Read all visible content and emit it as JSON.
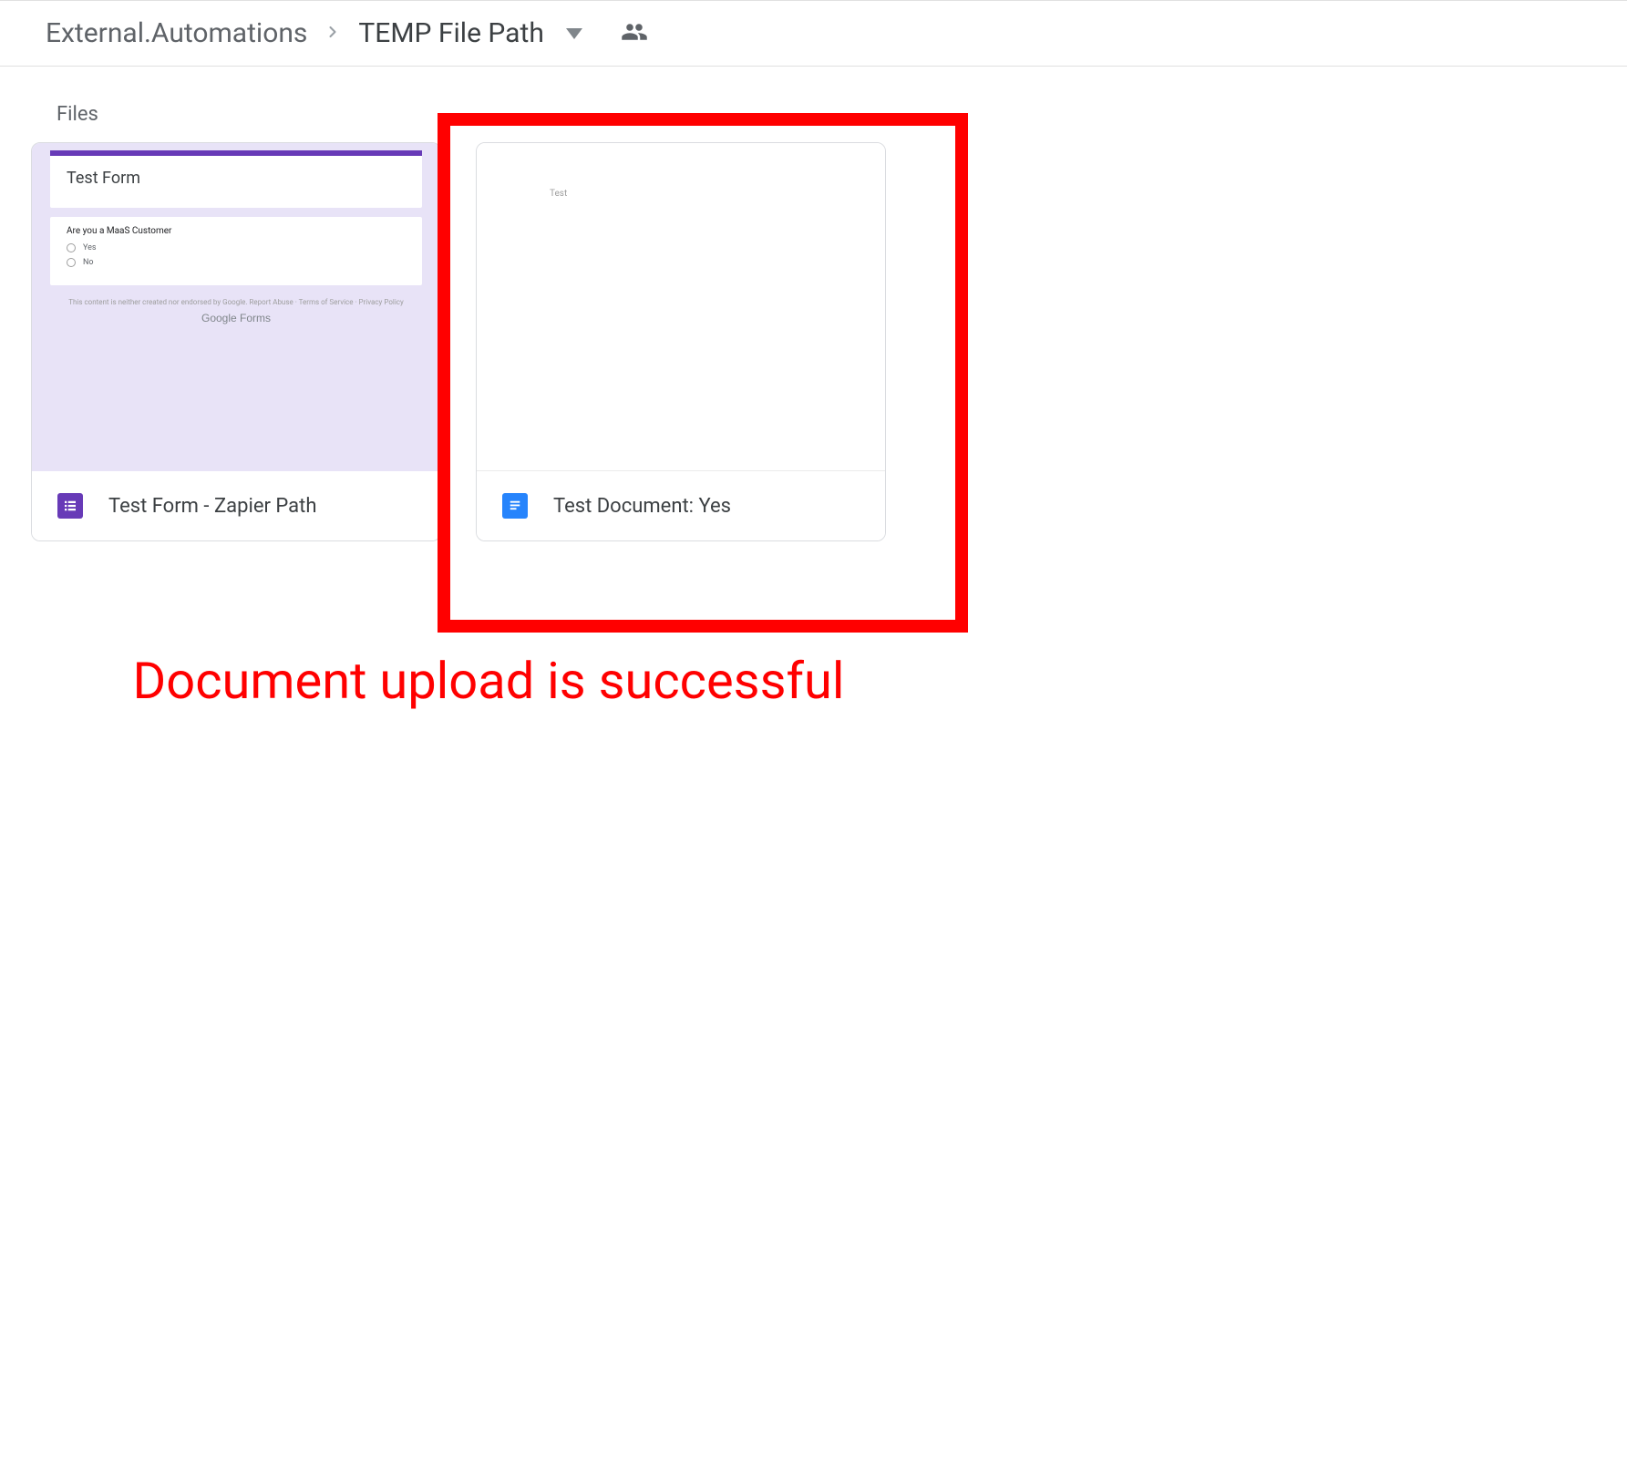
{
  "breadcrumb": {
    "parent": "External.Automations",
    "current": "TEMP File Path"
  },
  "section_label": "Files",
  "files": [
    {
      "name": "Test Form - Zapier Path",
      "type": "forms",
      "preview": {
        "title": "Test Form",
        "question": "Are you a MaaS Customer",
        "options": [
          "Yes",
          "No"
        ],
        "footer_line": "This content is neither created nor endorsed by Google. Report Abuse · Terms of Service · Privacy Policy",
        "brand": "Google Forms"
      }
    },
    {
      "name": "Test Document: Yes",
      "type": "docs",
      "preview_text": "Test"
    }
  ],
  "annotation": "Document upload is successful"
}
